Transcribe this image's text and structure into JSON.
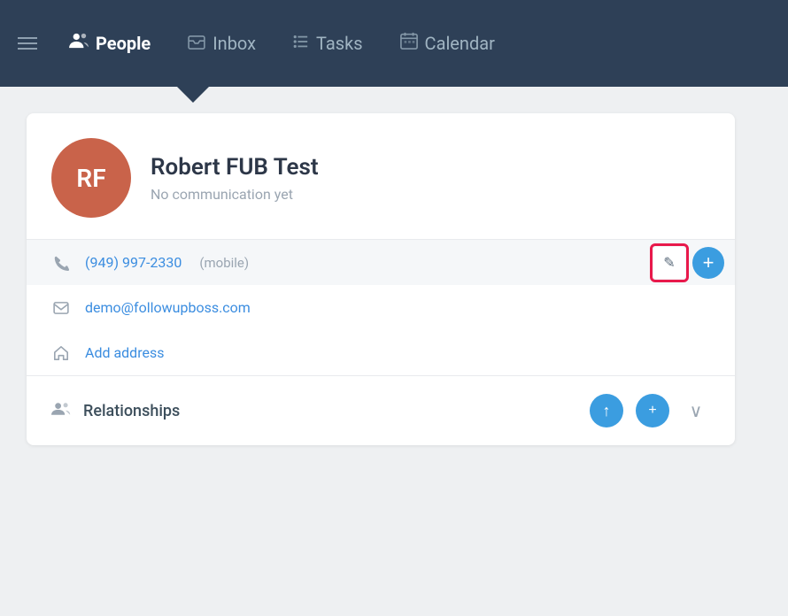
{
  "nav": {
    "hamburger_label": "menu",
    "items": [
      {
        "id": "people",
        "label": "People",
        "active": true
      },
      {
        "id": "inbox",
        "label": "Inbox",
        "active": false
      },
      {
        "id": "tasks",
        "label": "Tasks",
        "active": false
      },
      {
        "id": "calendar",
        "label": "Calendar",
        "active": false
      }
    ]
  },
  "contact": {
    "initials": "RF",
    "name": "Robert FUB Test",
    "status": "No communication yet",
    "phone": "(949) 997-2330",
    "phone_type": "(mobile)",
    "email": "demo@followupboss.com",
    "add_address_label": "Add address"
  },
  "relationships": {
    "label": "Relationships"
  },
  "buttons": {
    "edit_label": "✎",
    "add_label": "+",
    "chevron_label": "›",
    "relationship_link": "↑"
  },
  "colors": {
    "avatar_bg": "#c9634a",
    "nav_bg": "#2e4057",
    "accent_blue": "#3b9de0",
    "highlight_red": "#e8194b"
  }
}
